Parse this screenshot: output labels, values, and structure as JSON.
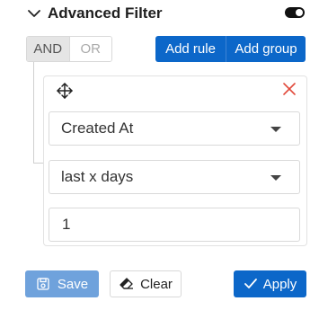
{
  "header": {
    "title": "Advanced Filter",
    "collapse_icon": "chevron-down-icon",
    "toggle_state": "on"
  },
  "conjunction": {
    "options": [
      "AND",
      "OR"
    ],
    "selected": "AND"
  },
  "actions": {
    "add_rule_label": "Add rule",
    "add_group_label": "Add group"
  },
  "rule": {
    "drag_icon": "move-icon",
    "remove_icon": "close-icon",
    "field_value": "Created At",
    "operator_value": "last x days",
    "input_value": "1"
  },
  "footer": {
    "save_label": "Save",
    "clear_label": "Clear",
    "apply_label": "Apply"
  },
  "colors": {
    "primary": "#0c67c9",
    "primary_disabled": "#6fa2dc",
    "remove": "#e24a3b"
  }
}
